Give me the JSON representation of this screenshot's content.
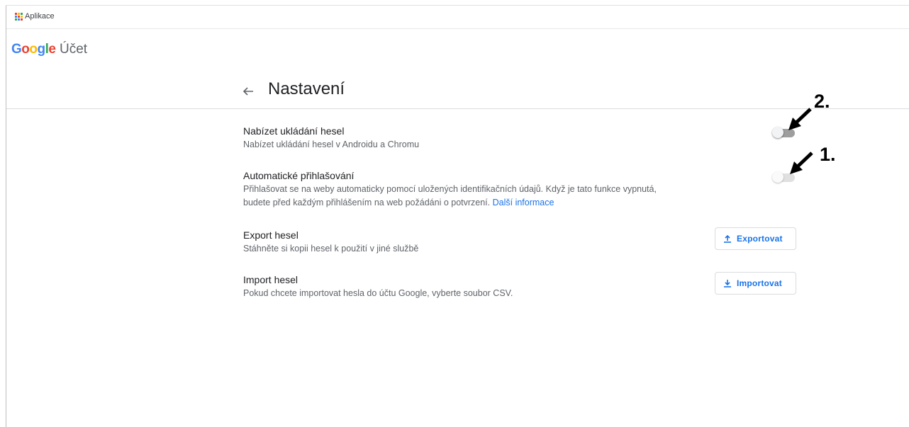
{
  "bookmarks": {
    "apps_label": "Aplikace"
  },
  "header": {
    "logo_letters": [
      "G",
      "o",
      "o",
      "g",
      "l",
      "e"
    ],
    "product": "Účet"
  },
  "page": {
    "title": "Nastavení"
  },
  "settings": {
    "offer_save": {
      "title": "Nabízet ukládání hesel",
      "desc": "Nabízet ukládání hesel v Androidu a Chromu",
      "enabled": false
    },
    "auto_signin": {
      "title": "Automatické přihlašování",
      "desc_line1": "Přihlašovat se na weby automaticky pomocí uložených identifikačních údajů. Když je tato funkce vypnutá,",
      "desc_line2": "budete před každým přihlášením na web požádáni o potvrzení.",
      "link": "Další informace",
      "enabled": false
    },
    "export": {
      "title": "Export hesel",
      "desc": "Stáhněte si kopii hesel k použití v jiné službě",
      "button": "Exportovat"
    },
    "import": {
      "title": "Import hesel",
      "desc": "Pokud chcete importovat hesla do účtu Google, vyberte soubor CSV.",
      "button": "Importovat"
    }
  },
  "annotations": {
    "step2": "2.",
    "step1": "1."
  },
  "colors": {
    "link": "#1a73e8",
    "toggle_track": "#9e9e9e",
    "google_blue": "#4285f4",
    "google_red": "#ea4335",
    "google_yellow": "#fbbc05",
    "google_green": "#34a853"
  },
  "icons": [
    "apps-grid-icon",
    "back-arrow-icon",
    "upload-icon",
    "download-icon"
  ]
}
